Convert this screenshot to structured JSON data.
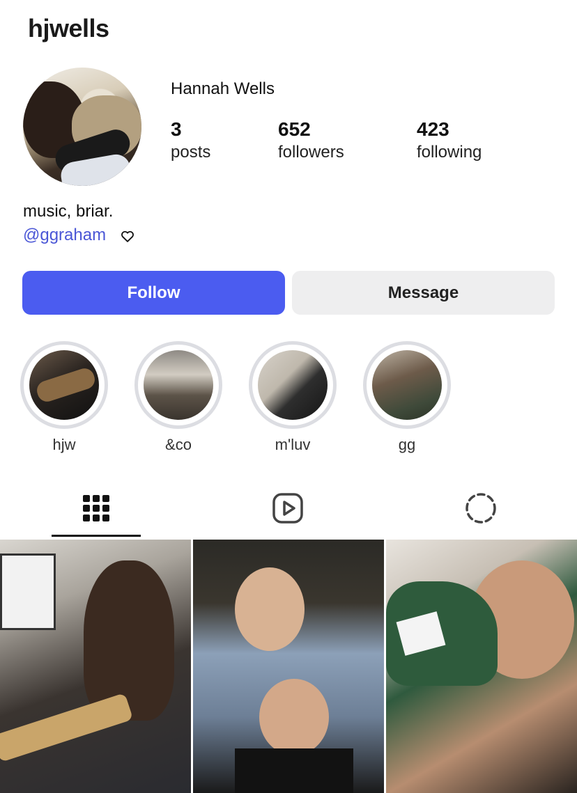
{
  "profile": {
    "username": "hjwells",
    "full_name": "Hannah Wells",
    "stats": {
      "posts": {
        "value": "3",
        "label": "posts"
      },
      "followers": {
        "value": "652",
        "label": "followers"
      },
      "following": {
        "value": "423",
        "label": "following"
      }
    },
    "bio": "music, briar.",
    "bio_link": "@ggraham",
    "bio_icon": "heart-outline-icon"
  },
  "actions": {
    "follow_label": "Follow",
    "message_label": "Message",
    "follow_color": "#4b5cf0"
  },
  "highlights": [
    {
      "label": "hjw"
    },
    {
      "label": "&co"
    },
    {
      "label": "m'luv"
    },
    {
      "label": "gg"
    }
  ],
  "tabs": [
    {
      "icon": "grid-icon",
      "active": true
    },
    {
      "icon": "reels-icon",
      "active": false
    },
    {
      "icon": "tagged-loading-icon",
      "active": false
    }
  ]
}
